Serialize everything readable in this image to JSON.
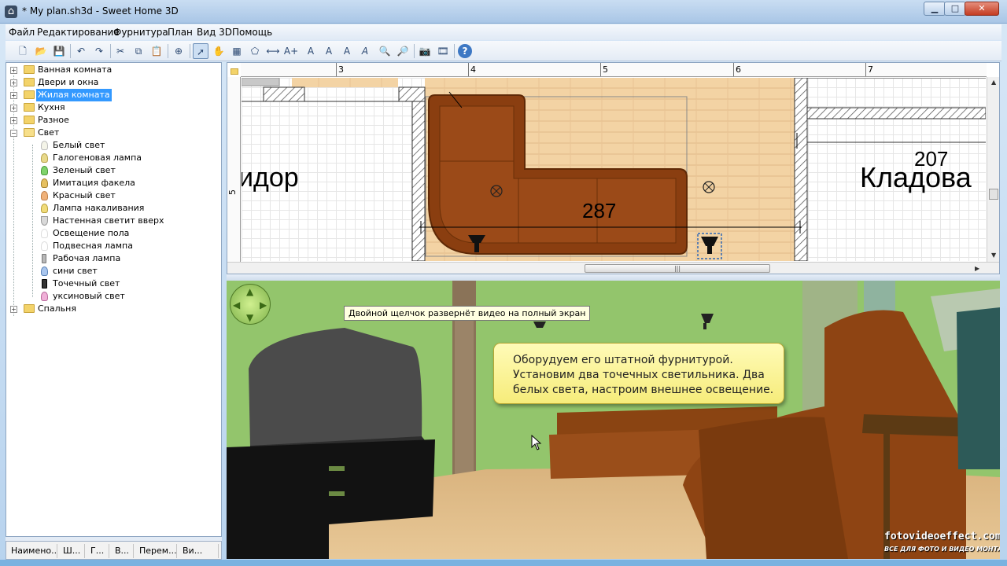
{
  "window": {
    "title": "* My plan.sh3d - Sweet Home 3D",
    "app_icon": "sweet-home-3d-icon",
    "minimize_glyph": "▁",
    "maximize_glyph": "□",
    "close_glyph": "✕"
  },
  "menu": [
    "Файл",
    "Редактирование",
    "Фурнитура",
    "План",
    "Вид 3D",
    "Помощь"
  ],
  "toolbar": {
    "buttons": [
      {
        "icon": "new-icon",
        "glyph": "🗋"
      },
      {
        "icon": "open-icon",
        "glyph": "📂"
      },
      {
        "icon": "save-icon",
        "glyph": "💾"
      },
      {
        "icon": "undo-icon",
        "glyph": "↶"
      },
      {
        "icon": "redo-icon",
        "glyph": "↷"
      },
      {
        "icon": "cut-icon",
        "glyph": "✂"
      },
      {
        "icon": "copy-icon",
        "glyph": "⧉"
      },
      {
        "icon": "paste-icon",
        "glyph": "📋"
      },
      {
        "icon": "add-furniture-icon",
        "glyph": "⊕"
      },
      {
        "icon": "select-mode-icon",
        "glyph": "➚"
      },
      {
        "icon": "pan-mode-icon",
        "glyph": "✋"
      },
      {
        "icon": "create-walls-icon",
        "glyph": "▦"
      },
      {
        "icon": "create-rooms-icon",
        "glyph": "⬠"
      },
      {
        "icon": "create-dimensions-icon",
        "glyph": "⟷"
      },
      {
        "icon": "add-text-icon",
        "glyph": "A+"
      },
      {
        "icon": "text-style-icon",
        "glyph": "A"
      },
      {
        "icon": "increase-text-icon",
        "glyph": "A"
      },
      {
        "icon": "decrease-text-icon",
        "glyph": "A"
      },
      {
        "icon": "italic-text-icon",
        "glyph": "A"
      },
      {
        "icon": "zoom-in-icon",
        "glyph": "🔍"
      },
      {
        "icon": "zoom-out-icon",
        "glyph": "🔎"
      },
      {
        "icon": "create-photo-icon",
        "glyph": "📷"
      },
      {
        "icon": "create-video-icon",
        "glyph": "🎞"
      },
      {
        "icon": "help-icon",
        "glyph": "?"
      }
    ]
  },
  "catalog": {
    "categories": [
      {
        "label": "Ванная комната",
        "expanded": false,
        "selected": false
      },
      {
        "label": "Двери и окна",
        "expanded": false,
        "selected": false
      },
      {
        "label": "Жилая комната",
        "expanded": false,
        "selected": true
      },
      {
        "label": "Кухня",
        "expanded": false,
        "selected": false
      },
      {
        "label": "Разное",
        "expanded": false,
        "selected": false
      },
      {
        "label": "Свет",
        "expanded": true,
        "selected": false
      },
      {
        "label": "Спальня",
        "expanded": false,
        "selected": false
      }
    ],
    "light_items": [
      {
        "label": "Белый свет",
        "color": "#f4f4e8"
      },
      {
        "label": "Галогеновая лампа",
        "color": "#e8d98a"
      },
      {
        "label": "Зеленый свет",
        "color": "#7fd36b"
      },
      {
        "label": "Имитация факела",
        "color": "#e6c060"
      },
      {
        "label": "Красный свет",
        "color": "#f0b27a"
      },
      {
        "label": "Лампа накаливания",
        "color": "#f1dc7a"
      },
      {
        "label": "Настенная светит вверх",
        "color": "#d9d9d9"
      },
      {
        "label": "Освещение пола",
        "color": "#ffffff"
      },
      {
        "label": "Подвесная лампа",
        "color": "#ffffff"
      },
      {
        "label": "Рабочая лампа",
        "color": "#b8b8b8"
      },
      {
        "label": "сини свет",
        "color": "#a9c6ee"
      },
      {
        "label": "Точечный свет",
        "color": "#333333"
      },
      {
        "label": "уксиновый свет",
        "color": "#f0b0d8"
      }
    ],
    "toggle_collapsed": "+",
    "toggle_expanded": "−"
  },
  "furniture_columns": [
    "Наимено...",
    "Ш...",
    "Г...",
    "В...",
    "Перем...",
    "Ви..."
  ],
  "plan": {
    "ruler_labels": [
      "3",
      "4",
      "5",
      "6",
      "7"
    ],
    "left_ruler_label": "5",
    "rooms": [
      {
        "name": "идор"
      },
      {
        "area": "207",
        "name": "Кладова"
      }
    ],
    "sofa_dimension": "287",
    "hscroll_grip": "|||"
  },
  "view3d": {
    "tooltip": "Двойной щелчок развернёт видео на полный экран",
    "info_lines": [
      "Оборудуем его штатной фурнитурой.",
      "Установим два точечных светильника. Два",
      "белых света, настроим внешнее освещение."
    ],
    "watermark": "fotovideoeffect.com",
    "watermark_sub": "ВСЕ ДЛЯ ФОТО И ВИДЕО МОНТАЖА!",
    "nav_arrows": [
      "▲",
      "▼",
      "◀",
      "▶"
    ]
  }
}
